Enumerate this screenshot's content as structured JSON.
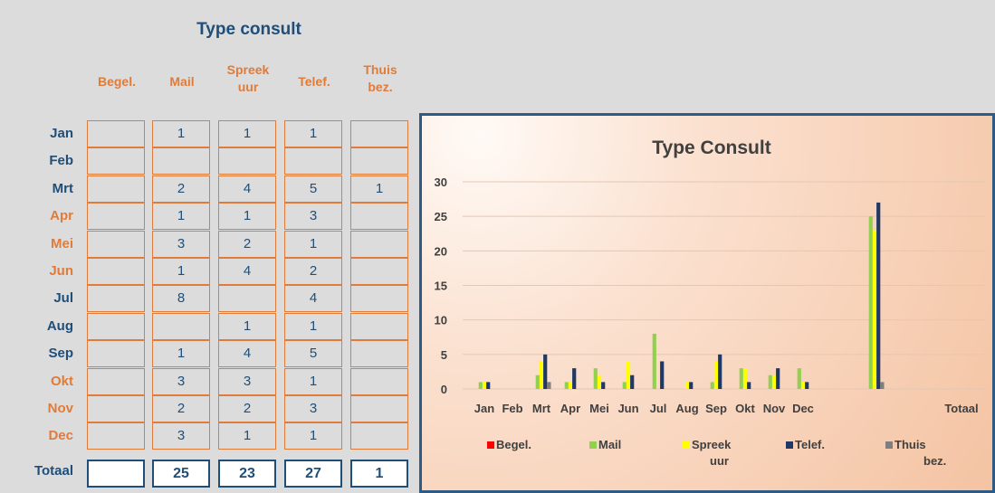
{
  "table": {
    "title": "Type consult",
    "headers": [
      "Begel.",
      "Mail",
      "Spreek uur",
      "Telef.",
      "Thuis bez."
    ],
    "header_lines": [
      [
        "Begel."
      ],
      [
        "Mail"
      ],
      [
        "Spreek",
        "uur"
      ],
      [
        "Telef."
      ],
      [
        "Thuis",
        "bez."
      ]
    ],
    "months": [
      "Jan",
      "Feb",
      "Mrt",
      "Apr",
      "Mei",
      "Jun",
      "Jul",
      "Aug",
      "Sep",
      "Okt",
      "Nov",
      "Dec"
    ],
    "month_colors": [
      "#1f4e79",
      "#1f4e79",
      "#1f4e79",
      "#e07b39",
      "#e07b39",
      "#e07b39",
      "#1f4e79",
      "#1f4e79",
      "#1f4e79",
      "#e07b39",
      "#e07b39",
      "#e07b39"
    ],
    "rows": [
      [
        "",
        "1",
        "1",
        "1",
        ""
      ],
      [
        "",
        "",
        "",
        "",
        ""
      ],
      [
        "",
        "2",
        "4",
        "5",
        "1"
      ],
      [
        "",
        "1",
        "1",
        "3",
        ""
      ],
      [
        "",
        "3",
        "2",
        "1",
        ""
      ],
      [
        "",
        "1",
        "4",
        "2",
        ""
      ],
      [
        "",
        "8",
        "",
        "4",
        ""
      ],
      [
        "",
        "",
        "1",
        "1",
        ""
      ],
      [
        "",
        "1",
        "4",
        "5",
        ""
      ],
      [
        "",
        "3",
        "3",
        "1",
        ""
      ],
      [
        "",
        "2",
        "2",
        "3",
        ""
      ],
      [
        "",
        "3",
        "1",
        "1",
        ""
      ]
    ],
    "total_label": "Totaal",
    "totals": [
      "",
      "25",
      "23",
      "27",
      "1"
    ]
  },
  "colors": {
    "blue_text": "#1f4e79",
    "orange_text": "#e07b39"
  },
  "chart_data": {
    "type": "bar",
    "title": "Type Consult",
    "categories": [
      "Jan",
      "Feb",
      "Mrt",
      "Apr",
      "Mei",
      "Jun",
      "Jul",
      "Aug",
      "Sep",
      "Okt",
      "Nov",
      "Dec",
      "Totaal"
    ],
    "series": [
      {
        "name": "Begel.",
        "color": "#ff0000",
        "values": [
          0,
          0,
          0,
          0,
          0,
          0,
          0,
          0,
          0,
          0,
          0,
          0,
          0
        ]
      },
      {
        "name": "Mail",
        "color": "#92d050",
        "values": [
          1,
          0,
          2,
          1,
          3,
          1,
          8,
          0,
          1,
          3,
          2,
          3,
          25
        ]
      },
      {
        "name": "Spreek uur",
        "color": "#ffff00",
        "values": [
          1,
          0,
          4,
          1,
          2,
          4,
          0,
          1,
          4,
          3,
          2,
          1,
          23
        ]
      },
      {
        "name": "Telef.",
        "color": "#203864",
        "values": [
          1,
          0,
          5,
          3,
          1,
          2,
          4,
          1,
          5,
          1,
          3,
          1,
          27
        ]
      },
      {
        "name": "Thuis bez.",
        "color": "#7f7f7f",
        "values": [
          0,
          0,
          1,
          0,
          0,
          0,
          0,
          0,
          0,
          0,
          0,
          0,
          1
        ]
      }
    ],
    "legend_lines": [
      [
        "Begel."
      ],
      [
        "Mail"
      ],
      [
        "Spreek",
        "uur"
      ],
      [
        "Telef."
      ],
      [
        "Thuis",
        "bez."
      ]
    ],
    "ylim": [
      0,
      30
    ],
    "yticks": [
      0,
      5,
      10,
      15,
      20,
      25,
      30
    ],
    "grid": true,
    "legend_position": "bottom"
  }
}
